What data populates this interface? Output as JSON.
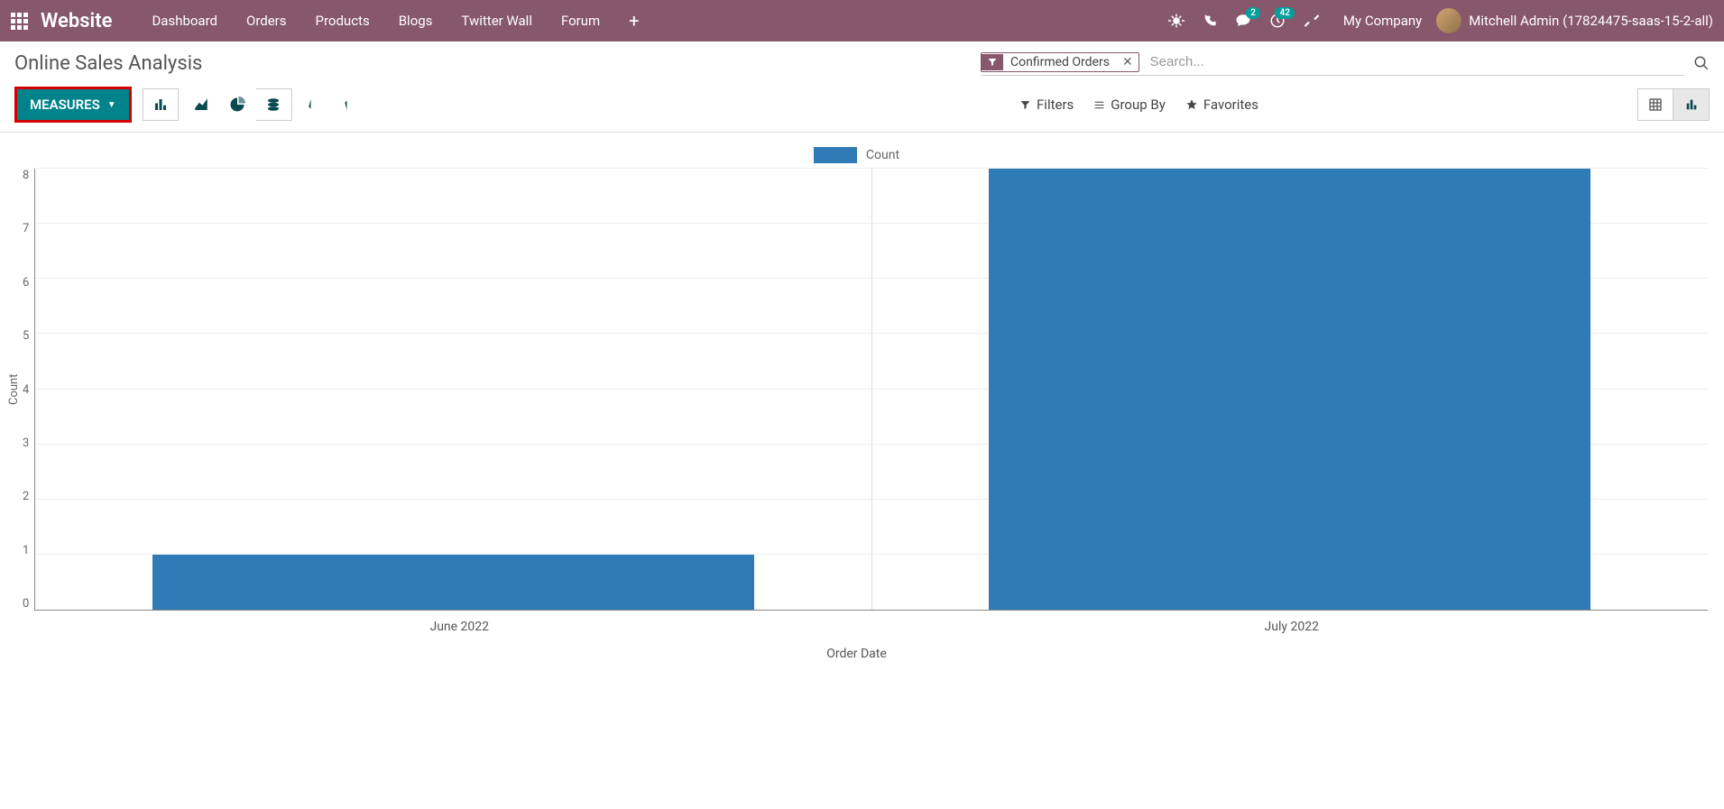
{
  "nav": {
    "brand": "Website",
    "items": [
      "Dashboard",
      "Orders",
      "Products",
      "Blogs",
      "Twitter Wall",
      "Forum"
    ],
    "chat_badge": "2",
    "clock_badge": "42",
    "company": "My Company",
    "user": "Mitchell Admin (17824475-saas-15-2-all)"
  },
  "page": {
    "title": "Online Sales Analysis"
  },
  "search": {
    "facet_label": "Confirmed Orders",
    "placeholder": "Search..."
  },
  "toolbar": {
    "measures": "MEASURES",
    "filters": "Filters",
    "group_by": "Group By",
    "favorites": "Favorites"
  },
  "chart_data": {
    "type": "bar",
    "title": "",
    "legend": "Count",
    "xlabel": "Order Date",
    "ylabel": "Count",
    "ylim": [
      0,
      8
    ],
    "yticks": [
      0,
      1,
      2,
      3,
      4,
      5,
      6,
      7,
      8
    ],
    "categories": [
      "June 2022",
      "July 2022"
    ],
    "values": [
      1,
      8
    ],
    "color": "#2f7bb5"
  }
}
